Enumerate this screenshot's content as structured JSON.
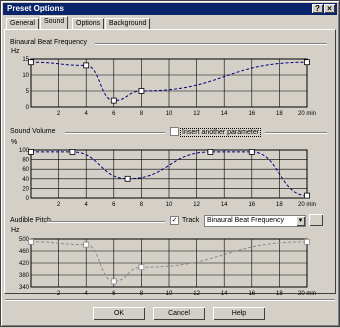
{
  "window": {
    "title": "Preset Options",
    "help_glyph": "?",
    "close_glyph": "×"
  },
  "tabs": [
    {
      "label": "General"
    },
    {
      "label": "Sound"
    },
    {
      "label": "Options"
    },
    {
      "label": "Background"
    }
  ],
  "sections": {
    "binaural": {
      "label": "Binaural Beat Frequency",
      "y_unit": "Hz"
    },
    "volume": {
      "label": "Sound Volume",
      "y_unit": "%",
      "checkbox_label": "Insert another parameter",
      "checkbox_checked": false
    },
    "pitch": {
      "label": "Audible Pitch",
      "y_unit": "Hz",
      "checkbox_label": "Track",
      "checkbox_checked": true,
      "checkbox_mark": "✓",
      "select_value": "Binaural Beat Frequency",
      "select_arrow": "▼"
    }
  },
  "chart_data": [
    {
      "type": "line",
      "title": "Binaural Beat Frequency",
      "ylabel": "Hz",
      "xlabel": "min",
      "xlim": [
        0,
        20
      ],
      "ylim": [
        0,
        15
      ],
      "x_ticks": [
        "2",
        "4",
        "6",
        "8",
        "10",
        "12",
        "14",
        "16",
        "18",
        "20 min"
      ],
      "y_ticks": [
        "15",
        "10",
        "5",
        "0"
      ],
      "grid": true,
      "series": [
        {
          "x": [
            0,
            4,
            6,
            8,
            20
          ],
          "y": [
            14,
            13,
            2,
            5,
            14
          ]
        }
      ]
    },
    {
      "type": "line",
      "title": "Sound Volume",
      "ylabel": "%",
      "xlabel": "min",
      "xlim": [
        0,
        20
      ],
      "ylim": [
        0,
        100
      ],
      "x_ticks": [
        "2",
        "4",
        "6",
        "8",
        "10",
        "12",
        "14",
        "16",
        "18",
        "20 min"
      ],
      "y_ticks": [
        "100",
        "80",
        "60",
        "40",
        "20",
        "0"
      ],
      "grid": true,
      "series": [
        {
          "x": [
            0,
            3,
            7,
            13,
            16,
            20
          ],
          "y": [
            96,
            96,
            40,
            96,
            96,
            5
          ]
        }
      ]
    },
    {
      "type": "line",
      "title": "Audible Pitch",
      "ylabel": "Hz",
      "xlabel": "min",
      "xlim": [
        0,
        20
      ],
      "ylim": [
        330,
        500
      ],
      "x_ticks": [
        "2",
        "4",
        "6",
        "8",
        "10",
        "12",
        "14",
        "16",
        "18",
        "20 min"
      ],
      "y_ticks": [
        "500",
        "460",
        "420",
        "380",
        "340"
      ],
      "grid": true,
      "series": [
        {
          "x": [
            0,
            4,
            6,
            8,
            20
          ],
          "y": [
            490,
            480,
            350,
            400,
            490
          ]
        }
      ]
    }
  ],
  "buttons": {
    "ok": "OK",
    "cancel": "Cancel",
    "help": "Help"
  }
}
